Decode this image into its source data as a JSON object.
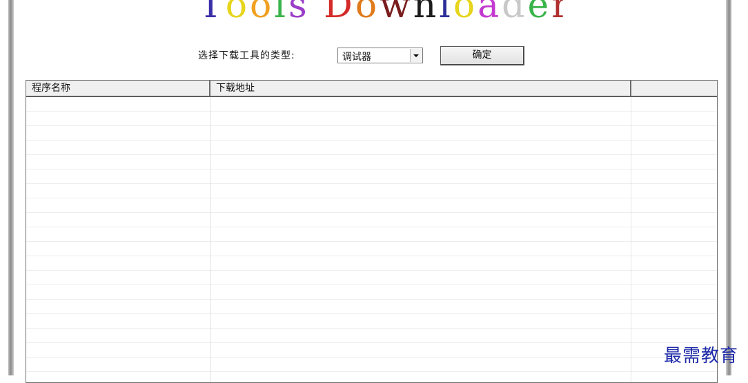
{
  "title": {
    "text": "Tools Downloader",
    "letters": [
      {
        "ch": "T",
        "color": "#3a2fa8"
      },
      {
        "ch": "o",
        "color": "#e6d51a"
      },
      {
        "ch": "o",
        "color": "#f0a020"
      },
      {
        "ch": "l",
        "color": "#38b44a"
      },
      {
        "ch": "s",
        "color": "#9a3ec8"
      },
      {
        "ch": " ",
        "color": "#ffffff"
      },
      {
        "ch": "D",
        "color": "#d42a2a"
      },
      {
        "ch": "o",
        "color": "#e07a1a"
      },
      {
        "ch": "w",
        "color": "#7a1c1c"
      },
      {
        "ch": "n",
        "color": "#1c1c1c"
      },
      {
        "ch": "l",
        "color": "#2d2d9a"
      },
      {
        "ch": "o",
        "color": "#e6d51a"
      },
      {
        "ch": "a",
        "color": "#c43ad0"
      },
      {
        "ch": "d",
        "color": "#c8c8c8"
      },
      {
        "ch": "e",
        "color": "#38b44a"
      },
      {
        "ch": "r",
        "color": "#b03030"
      }
    ]
  },
  "controls": {
    "type_label": "选择下载工具的类型:",
    "type_select": {
      "value": "调试器"
    },
    "confirm_label": "确定"
  },
  "list": {
    "columns": [
      "程序名称",
      "下载地址",
      ""
    ],
    "rows": []
  },
  "watermark": "最需教育"
}
